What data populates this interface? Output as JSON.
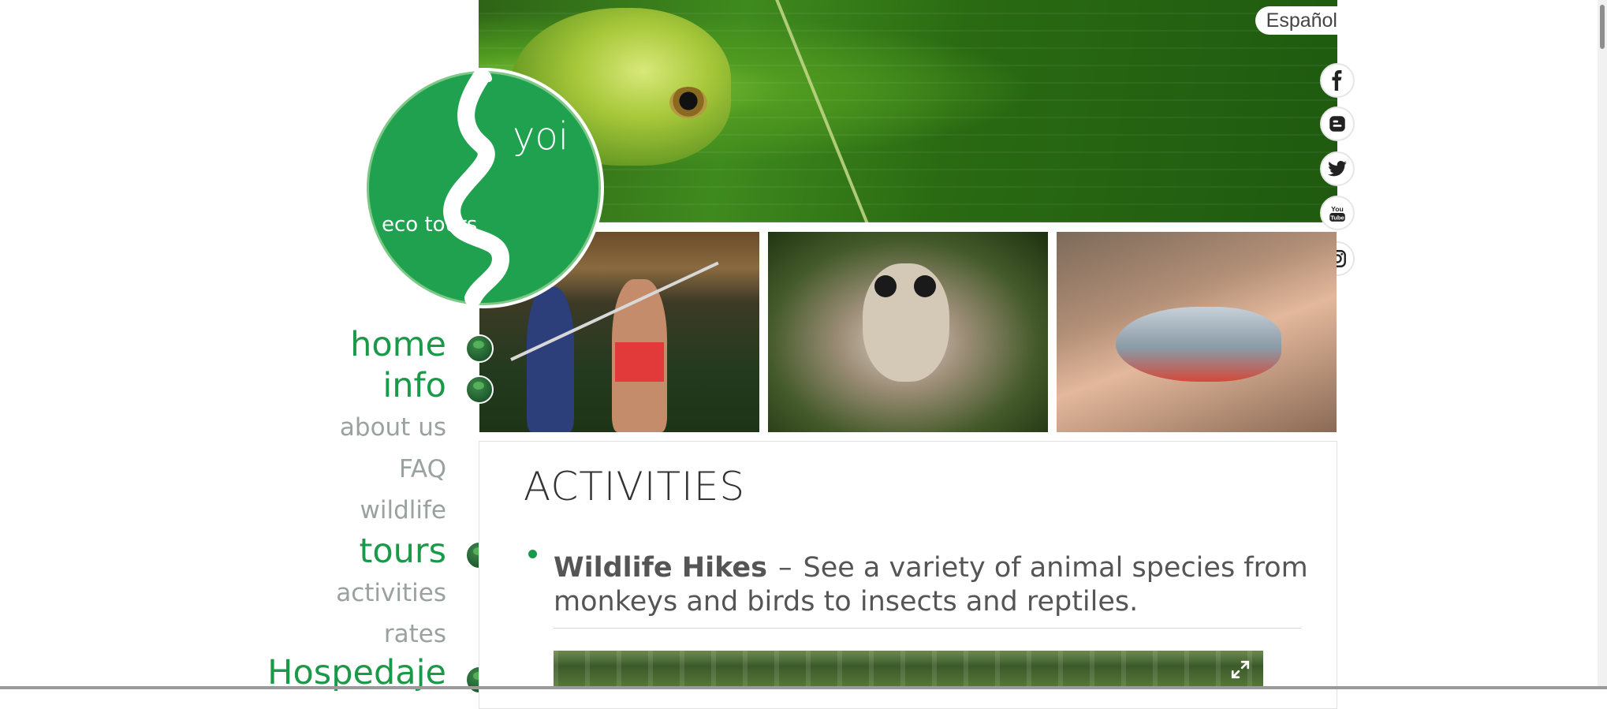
{
  "language_switch": {
    "label": "Español"
  },
  "social": [
    {
      "name": "facebook-icon"
    },
    {
      "name": "blogger-icon"
    },
    {
      "name": "twitter-icon"
    },
    {
      "name": "youtube-icon"
    },
    {
      "name": "instagram-icon"
    }
  ],
  "logo": {
    "top_text": "yoi",
    "bottom_text": "eco tours"
  },
  "nav": {
    "home": "home",
    "info": "info",
    "about_us": "about us",
    "faq": "FAQ",
    "wildlife": "wildlife",
    "tours": "tours",
    "activities": "activities",
    "rates": "rates",
    "hospedaje": "Hospedaje"
  },
  "content": {
    "title": "ACTIVITIES",
    "items": [
      {
        "title": "Wildlife Hikes",
        "separator": "–",
        "description": "See a variety of animal species from monkeys and birds to insects and reptiles."
      }
    ]
  },
  "colors": {
    "brand_green": "#1a9a48",
    "nav_sub_gray": "#9aa2a0",
    "logo_green": "#1fa150"
  }
}
